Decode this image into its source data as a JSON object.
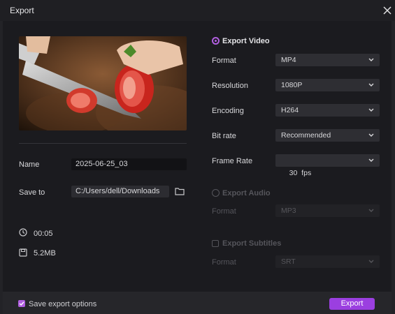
{
  "window": {
    "title": "Export"
  },
  "left": {
    "name_label": "Name",
    "name_value": "2025-06-25_03",
    "save_to_label": "Save to",
    "save_to_value": "C:/Users/dell/Downloads",
    "duration": "00:05",
    "size": "5.2MB"
  },
  "video": {
    "section_label": "Export Video",
    "rows": [
      {
        "label": "Format",
        "value": "MP4"
      },
      {
        "label": "Resolution",
        "value": "1080P"
      },
      {
        "label": "Encoding",
        "value": "H264"
      },
      {
        "label": "Bit rate",
        "value": "Recommended"
      },
      {
        "label": "Frame Rate",
        "value": "30  fps"
      }
    ]
  },
  "audio": {
    "section_label": "Export Audio",
    "format_label": "Format",
    "format_value": "MP3"
  },
  "subtitles": {
    "section_label": "Export Subtitles",
    "format_label": "Format",
    "format_value": "SRT"
  },
  "footer": {
    "save_options_label": "Save export options",
    "export_button": "Export"
  },
  "colors": {
    "accent": "#9b3fe0",
    "radio": "#b15fe0",
    "background": "#1b1b1f"
  },
  "icons": {
    "close": "close-icon",
    "folder": "folder-icon",
    "clock": "clock-icon",
    "disk": "save-disk-icon",
    "chevron": "chevron-down-icon"
  }
}
